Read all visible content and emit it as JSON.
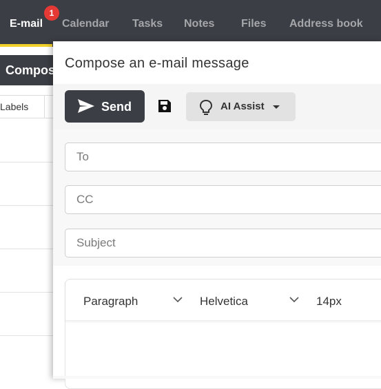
{
  "nav": {
    "items": [
      {
        "label": "E-mail",
        "active": true
      },
      {
        "label": "Calendar"
      },
      {
        "label": "Tasks"
      },
      {
        "label": "Notes"
      },
      {
        "label": "Files"
      },
      {
        "label": "Address book"
      }
    ],
    "badge_count": "1",
    "accent_color": "#f2d12a",
    "badge_color": "#e53935"
  },
  "background": {
    "compose_label": "Compos",
    "labels_column": "Labels"
  },
  "modal": {
    "title": "Compose an e-mail message",
    "toolbar": {
      "send_label": "Send",
      "send_icon": "paper-plane-icon",
      "save_icon": "floppy-disk-icon",
      "ai_label": "AI Assist",
      "ai_icon": "lightbulb-icon"
    },
    "fields": {
      "to_placeholder": "To",
      "cc_placeholder": "CC",
      "subject_placeholder": "Subject"
    },
    "editor": {
      "block_format": "Paragraph",
      "font_family": "Helvetica",
      "font_size": "14px"
    }
  }
}
